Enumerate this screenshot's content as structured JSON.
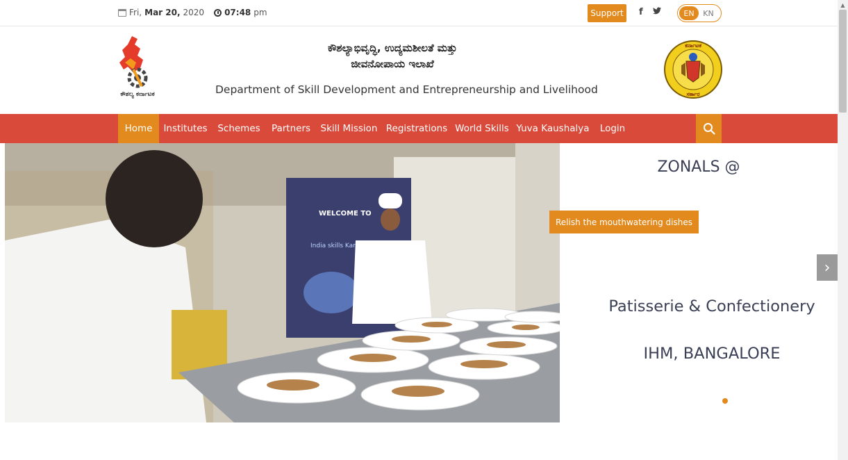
{
  "topbar": {
    "day": "Fri,",
    "month_date": "Mar  20,",
    "year": "2020",
    "time": "07:48",
    "ampm": "pm",
    "support_label": "Support",
    "facebook": "f",
    "twitter": "y",
    "languages": [
      "EN",
      "KN"
    ],
    "active_language": "EN"
  },
  "header": {
    "title_kn_line1": "ಕೌಶಲ್ಯಾಭಿವೃದ್ಧಿ, ಉದ್ಯಮಶೀಲತೆ ಮತ್ತು",
    "title_kn_line2": "ಜೀವನೋಪಾಯ ಇಲಾಖೆ",
    "title_en": "Department of Skill Development and Entrepreneurship and Livelihood",
    "logo_text": "ಕೌಶಲ್ಯ ಕರ್ನಾಟಕ",
    "emblem_top_text": "ಕರ್ನಾಟಕ",
    "emblem_bottom_text": "ಸರ್ಕಾರ"
  },
  "nav": {
    "items": [
      "Home",
      "Institutes",
      "Schemes",
      "Partners",
      "Skill Mission",
      "Registrations",
      "World Skills",
      "Yuva Kaushalya",
      "Login"
    ],
    "active": "Home"
  },
  "slider": {
    "heading": "ZONALS @",
    "caption": "Relish the mouthwatering dishes",
    "line2": "Patisserie & Confectionery",
    "line3": "IHM, BANGALORE",
    "banner_text": "WELCOME TO",
    "banner_sub": "India skills Karnataka",
    "next_glyph": "›"
  },
  "colors": {
    "accent": "#e38a1f",
    "nav_bg": "#d94a3a",
    "heading": "#3a3f55"
  }
}
